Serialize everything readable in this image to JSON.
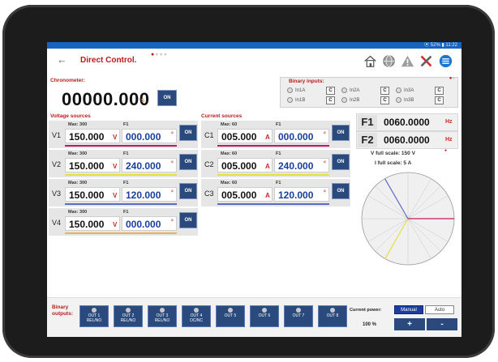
{
  "status_bar": {
    "text": "⦿ 52% ▮ 11:22"
  },
  "header": {
    "back_glyph": "←",
    "title": "Direct Control.",
    "icons": [
      "home-icon",
      "globe-icon",
      "warning-icon",
      "tools-icon",
      "menu-list-icon"
    ]
  },
  "chronometer": {
    "label": "Chronometer:",
    "value": "00000.000",
    "unit": "s.",
    "button": "ON"
  },
  "binary_inputs": {
    "label": "Binary inputs:",
    "items": [
      {
        "name": "In1A",
        "flag": "C"
      },
      {
        "name": "In2A",
        "flag": "C"
      },
      {
        "name": "In3A",
        "flag": "C"
      },
      {
        "name": "In1B",
        "flag": "C"
      },
      {
        "name": "In2B",
        "flag": "C"
      },
      {
        "name": "In3B",
        "flag": "C"
      }
    ]
  },
  "voltage_sources": {
    "title": "Voltage sources",
    "rows": [
      {
        "name": "V1",
        "max_label": "Max: 300",
        "amp": "150.000",
        "amp_unit": "V",
        "phase_label": "F1",
        "phase": "000.000",
        "deg": "°",
        "button": "ON",
        "color": "#c2185b"
      },
      {
        "name": "V2",
        "max_label": "Max: 300",
        "amp": "150.000",
        "amp_unit": "V",
        "phase_label": "F1",
        "phase": "240.000",
        "deg": "°",
        "button": "ON",
        "color": "#e6e03c"
      },
      {
        "name": "V3",
        "max_label": "Max: 300",
        "amp": "150.000",
        "amp_unit": "V",
        "phase_label": "F1",
        "phase": "120.000",
        "deg": "°",
        "button": "ON",
        "color": "#5c6bc0"
      },
      {
        "name": "V4",
        "max_label": "Max: 300",
        "amp": "150.000",
        "amp_unit": "V",
        "phase_label": "F1",
        "phase": "000.000",
        "deg": "°",
        "button": "ON",
        "color": "#e8b15a"
      }
    ]
  },
  "current_sources": {
    "title": "Current sources",
    "rows": [
      {
        "name": "C1",
        "max_label": "Max: 60",
        "amp": "005.000",
        "amp_unit": "A",
        "phase_label": "F1",
        "phase": "000.000",
        "deg": "°",
        "button": "ON",
        "color": "#c2185b"
      },
      {
        "name": "C2",
        "max_label": "Max: 60",
        "amp": "005.000",
        "amp_unit": "A",
        "phase_label": "F1",
        "phase": "240.000",
        "deg": "°",
        "button": "ON",
        "color": "#e6e03c"
      },
      {
        "name": "C3",
        "max_label": "Max: 60",
        "amp": "005.000",
        "amp_unit": "A",
        "phase_label": "F1",
        "phase": "120.000",
        "deg": "°",
        "button": "ON",
        "color": "#5c6bc0"
      }
    ]
  },
  "frequencies": [
    {
      "name": "F1",
      "value": "0060.0000",
      "unit": "Hz"
    },
    {
      "name": "F2",
      "value": "0060.0000",
      "unit": "Hz"
    }
  ],
  "full_scale": {
    "voltage": "V full scale: 150 V",
    "current": "I full scale: 5 A"
  },
  "binary_outputs": {
    "label": "Binary outputs:",
    "buttons": [
      {
        "line1": "OUT 1",
        "line2": "REL/NO"
      },
      {
        "line1": "OUT 2",
        "line2": "REL/NO"
      },
      {
        "line1": "OUT 3",
        "line2": "REL/NO"
      },
      {
        "line1": "OUT 4",
        "line2": "OC/NC"
      },
      {
        "line1": "OUT 5",
        "line2": ""
      },
      {
        "line1": "OUT 6",
        "line2": ""
      },
      {
        "line1": "OUT 7",
        "line2": ""
      },
      {
        "line1": "OUT 8",
        "line2": ""
      }
    ]
  },
  "power": {
    "label": "Current power:",
    "manual": "Manual",
    "auto": "Auto",
    "percent": "100 %",
    "plus": "+",
    "minus": "-"
  },
  "colors": {
    "accent": "#2a4a7e",
    "title_red": "#b71c1c",
    "status_blue": "#1565c0"
  }
}
